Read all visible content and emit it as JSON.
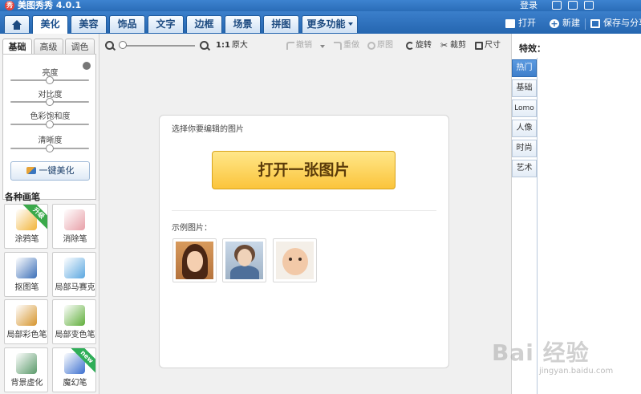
{
  "window": {
    "title": "美图秀秀 4.0.1",
    "logo_text": "秀",
    "login": "登录"
  },
  "menu": {
    "tabs": [
      {
        "label": "美化",
        "active": true
      },
      {
        "label": "美容"
      },
      {
        "label": "饰品"
      },
      {
        "label": "文字"
      },
      {
        "label": "边框"
      },
      {
        "label": "场景"
      },
      {
        "label": "拼图"
      },
      {
        "label": "更多功能"
      }
    ],
    "open": "打开",
    "new": "新建",
    "save_share": "保存与分享"
  },
  "left": {
    "subtabs": [
      "基础",
      "高级",
      "调色"
    ],
    "sliders": [
      {
        "label": "亮度",
        "value": 0.5
      },
      {
        "label": "对比度",
        "value": 0.5
      },
      {
        "label": "色彩饱和度",
        "value": 0.5
      },
      {
        "label": "清晰度",
        "value": 0.5
      }
    ],
    "onekey": "一键美化",
    "brushes_heading": "各种画笔",
    "brushes": [
      {
        "label": "涂鸦笔",
        "badge": "升级",
        "color": "#f2b53a"
      },
      {
        "label": "消除笔",
        "badge": "",
        "color": "#e8a0a8"
      },
      {
        "label": "抠图笔",
        "badge": "",
        "color": "#3b6fb8"
      },
      {
        "label": "局部马赛克",
        "badge": "",
        "color": "#5aa7e0"
      },
      {
        "label": "局部彩色笔",
        "badge": "",
        "color": "#d6952e"
      },
      {
        "label": "局部变色笔",
        "badge": "",
        "color": "#5fae3a"
      },
      {
        "label": "背景虚化",
        "badge": "",
        "color": "#5a9a6a"
      },
      {
        "label": "魔幻笔",
        "badge": "new",
        "color": "#3b6fcf"
      }
    ]
  },
  "toolbar": {
    "zoom_value": 0.0,
    "ratio": "1:1",
    "original": "原大",
    "undo": "撤销",
    "redo": "重做",
    "original_img": "原图",
    "rotate": "旋转",
    "crop": "裁剪",
    "size": "尺寸"
  },
  "card": {
    "prompt": "选择你要编辑的图片",
    "open_button": "打开一张图片",
    "samples_label": "示例图片："
  },
  "right": {
    "title": "特效：",
    "tabs": [
      {
        "label": "热门",
        "active": true
      },
      {
        "label": "基础"
      },
      {
        "label": "Lomo"
      },
      {
        "label": "人像"
      },
      {
        "label": "时尚"
      },
      {
        "label": "艺术"
      }
    ]
  },
  "watermark": {
    "main": "Bai 经验",
    "sub": "jingyan.baidu.com"
  },
  "colors": {
    "brand_blue": "#2a6db8",
    "open_button": "#fbc43b",
    "active_fx": "#3f7fcb"
  }
}
